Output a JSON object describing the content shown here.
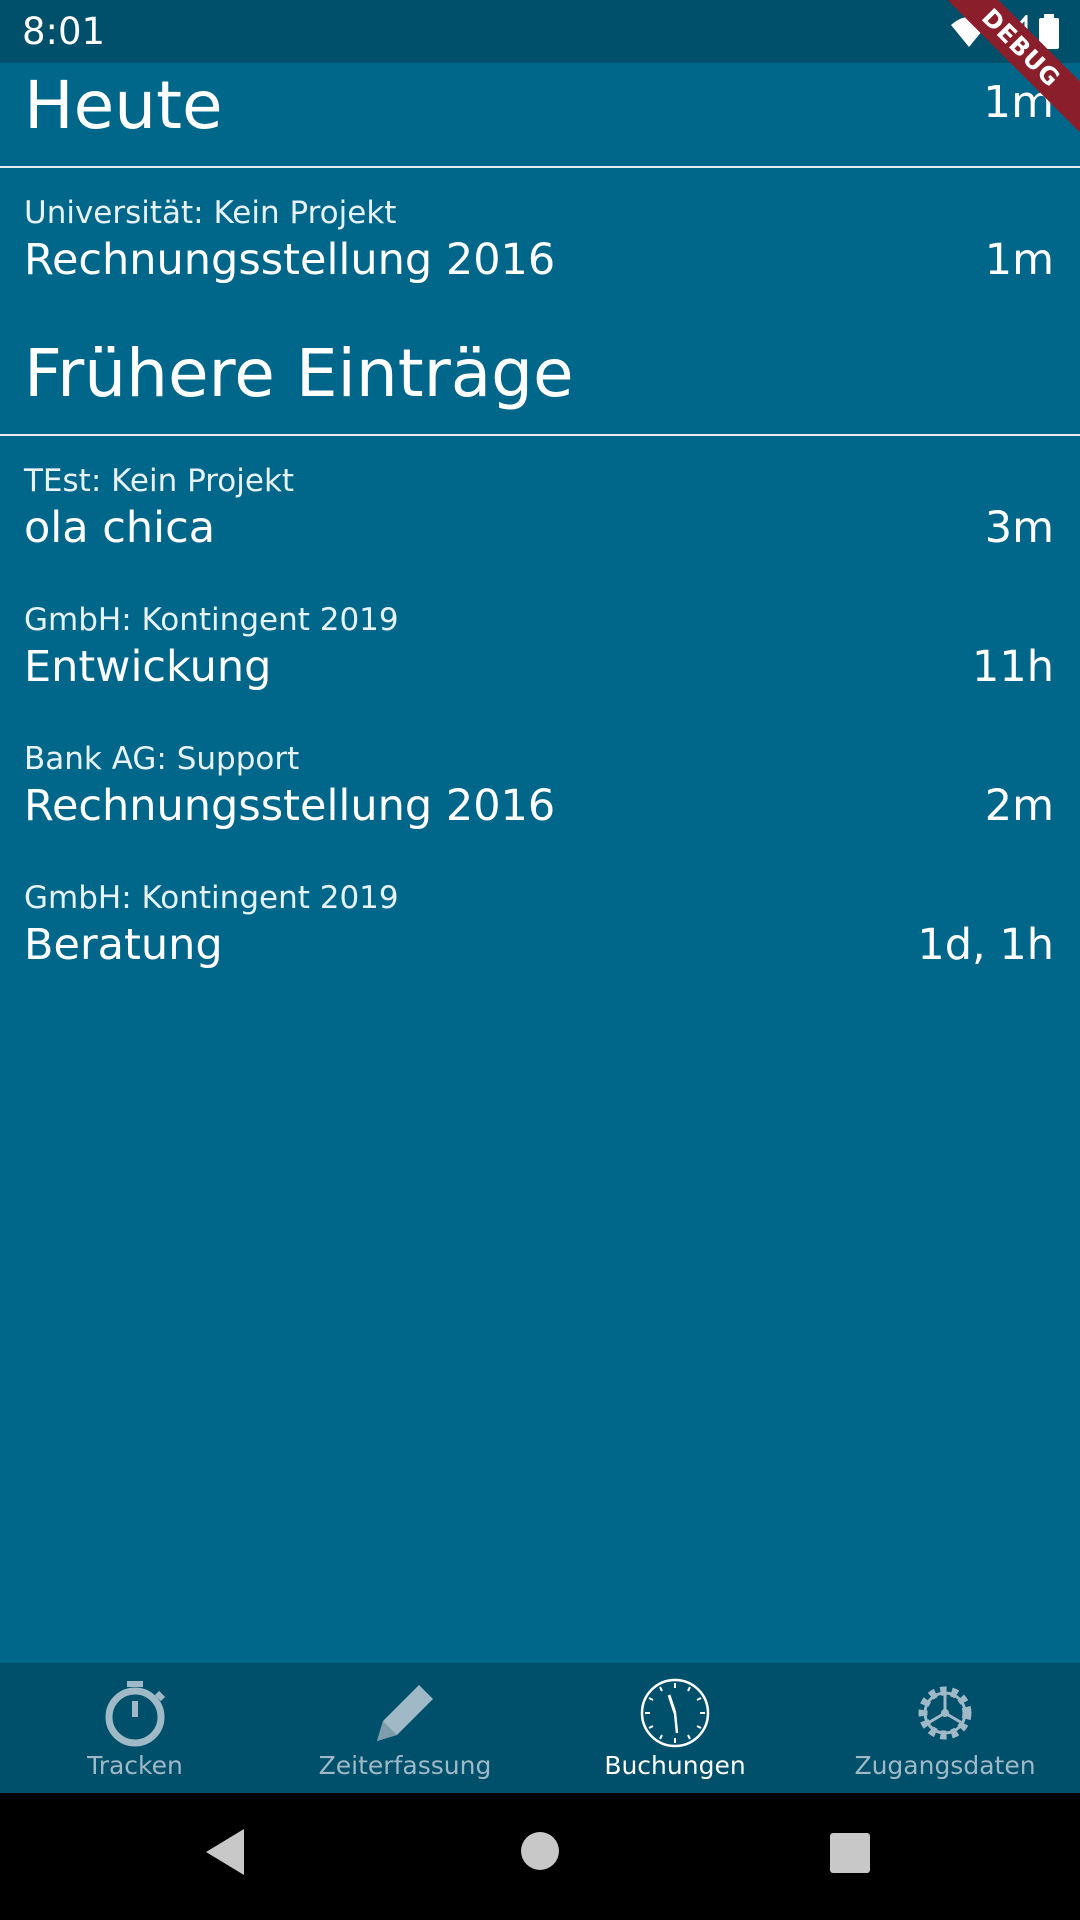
{
  "status_bar": {
    "time": "8:01",
    "debug_label": "DEBUG",
    "icons": [
      "wifi-icon",
      "signal-icon",
      "battery-icon"
    ]
  },
  "sections": [
    {
      "title": "Heute",
      "total": "1m",
      "entries": [
        {
          "subtitle": "Universität: Kein Projekt",
          "title": "Rechnungsstellung 2016",
          "duration": "1m"
        }
      ]
    },
    {
      "title": "Frühere Einträge",
      "total": "",
      "entries": [
        {
          "subtitle": "TEst: Kein Projekt",
          "title": "ola chica",
          "duration": "3m"
        },
        {
          "subtitle": "GmbH: Kontingent 2019",
          "title": "Entwickung",
          "duration": "11h"
        },
        {
          "subtitle": "Bank AG: Support",
          "title": "Rechnungsstellung 2016",
          "duration": "2m"
        },
        {
          "subtitle": "GmbH: Kontingent 2019",
          "title": "Beratung",
          "duration": "1d, 1h"
        }
      ]
    }
  ],
  "bottom_nav": {
    "items": [
      {
        "label": "Tracken",
        "icon": "stopwatch-icon",
        "active": false
      },
      {
        "label": "Zeiterfassung",
        "icon": "pencil-icon",
        "active": false
      },
      {
        "label": "Buchungen",
        "icon": "clock-icon",
        "active": true
      },
      {
        "label": "Zugangsdaten",
        "icon": "gear-icon",
        "active": false
      }
    ]
  },
  "colors": {
    "background": "#00678a",
    "bars": "#004f6b",
    "debug_ribbon": "#8a1f2b"
  }
}
